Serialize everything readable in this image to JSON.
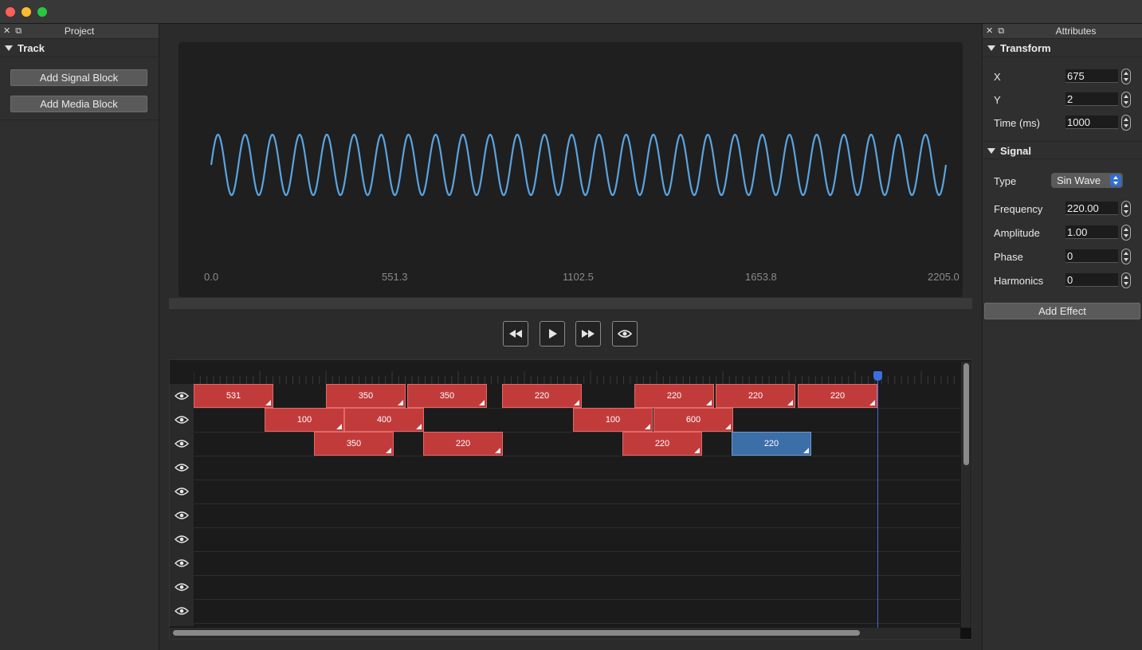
{
  "window": {
    "colors": {
      "close": "#ff5f57",
      "minimize": "#febc2e",
      "zoom": "#28c840"
    }
  },
  "project_panel": {
    "title": "Project",
    "section": "Track",
    "add_signal_block": "Add Signal Block",
    "add_media_block": "Add Media Block"
  },
  "attributes_panel": {
    "title": "Attributes",
    "transform": {
      "title": "Transform",
      "fields": [
        {
          "label": "X",
          "value": "675"
        },
        {
          "label": "Y",
          "value": "2"
        },
        {
          "label": "Time (ms)",
          "value": "1000"
        }
      ]
    },
    "signal": {
      "title": "Signal",
      "type_label": "Type",
      "type_value": "Sin Wave",
      "fields": [
        {
          "label": "Frequency",
          "value": "220.00"
        },
        {
          "label": "Amplitude",
          "value": "1.00"
        },
        {
          "label": "Phase",
          "value": "0"
        },
        {
          "label": "Harmonics",
          "value": "0"
        }
      ]
    },
    "add_effect": "Add Effect"
  },
  "waveform": {
    "axis_labels": [
      "0.0",
      "551.3",
      "1102.5",
      "1653.8",
      "2205.0"
    ],
    "cycles": 27,
    "color": "#5aa4e0"
  },
  "transport": {
    "rewind": "rewind-icon",
    "play": "play-icon",
    "fast_forward": "fast-forward-icon",
    "preview": "eye-icon"
  },
  "timeline": {
    "rows": [
      [
        {
          "label": "531"
        },
        {
          "label": "350"
        },
        {
          "label": "350"
        },
        {
          "label": "220"
        },
        {
          "label": "220"
        },
        {
          "label": "220"
        },
        {
          "label": "220"
        }
      ],
      [
        {
          "label": "100"
        },
        {
          "label": "400"
        },
        {
          "label": "100"
        },
        {
          "label": "600"
        }
      ],
      [
        {
          "label": "350"
        },
        {
          "label": "220"
        },
        {
          "label": "220"
        },
        {
          "label": "220",
          "selected": true
        }
      ]
    ],
    "track_count": 10,
    "block_color": "#c23b3b",
    "selected_color": "#3c6ea8",
    "playhead_color": "#3b6fe0"
  }
}
